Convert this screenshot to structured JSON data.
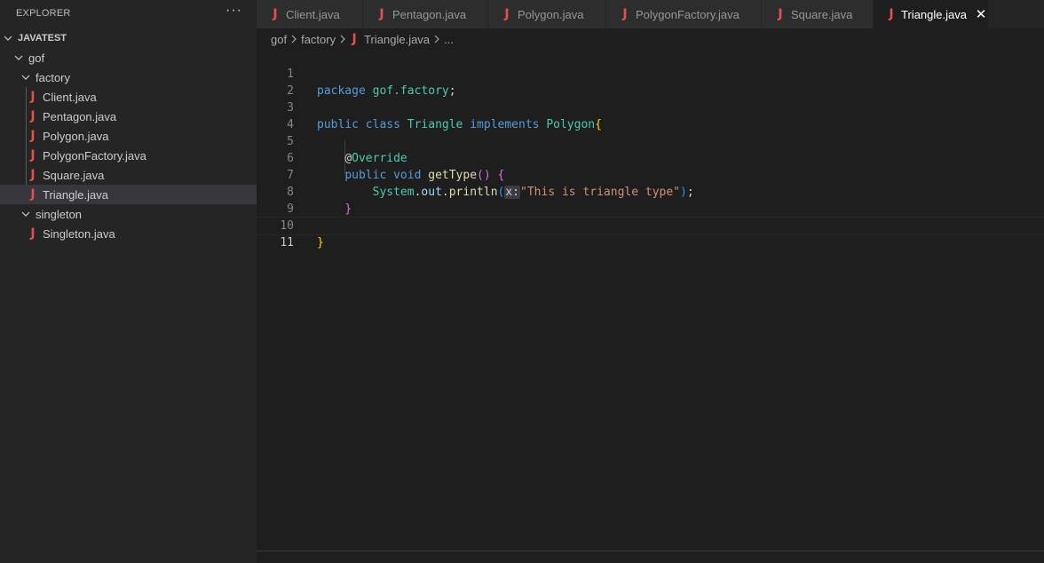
{
  "sidebar": {
    "title": "EXPLORER",
    "more": "···",
    "project": "JAVATEST",
    "folders": {
      "gof": "gof",
      "factory": "factory",
      "singleton": "singleton"
    },
    "factory_files": [
      "Client.java",
      "Pentagon.java",
      "Polygon.java",
      "PolygonFactory.java",
      "Square.java",
      "Triangle.java"
    ],
    "singleton_files": [
      "Singleton.java"
    ],
    "selected": "Triangle.java"
  },
  "tabs": [
    {
      "label": "Client.java",
      "active": false
    },
    {
      "label": "Pentagon.java",
      "active": false
    },
    {
      "label": "Polygon.java",
      "active": false
    },
    {
      "label": "PolygonFactory.java",
      "active": false
    },
    {
      "label": "Square.java",
      "active": false
    },
    {
      "label": "Triangle.java",
      "active": true
    }
  ],
  "tab_close": "✕",
  "file_icon": "J",
  "breadcrumb": {
    "items": [
      "gof",
      "factory",
      "Triangle.java",
      "..."
    ]
  },
  "editor": {
    "line_numbers": [
      "1",
      "2",
      "3",
      "4",
      "5",
      "6",
      "7",
      "8",
      "9",
      "10",
      "11"
    ],
    "current_line": "11",
    "code": {
      "l1": {
        "kw": "package",
        "pkg": "gof.factory",
        "semi": ";"
      },
      "l3": {
        "kw1": "public",
        "kw2": "class",
        "cls": "Triangle",
        "kw3": "implements",
        "iface": "Polygon",
        "brace": "{"
      },
      "l5": {
        "at": "@",
        "ann": "Override"
      },
      "l6": {
        "kw1": "public",
        "kw2": "void",
        "fn": "getType",
        "parens": "()",
        "brace": "{"
      },
      "l7": {
        "obj": "System",
        "dot1": ".",
        "field": "out",
        "dot2": ".",
        "fn": "println",
        "open": "(",
        "hint": "x:",
        "str": "\"This is triangle type\"",
        "close": ")",
        "semi": ";"
      },
      "l9_brace": "}",
      "l10_brace": "}"
    }
  },
  "colors": {
    "keyword": "#569cd6",
    "type": "#4ec9b0",
    "function": "#dcdcaa",
    "string": "#ce9178",
    "java_icon": "#e4504b"
  }
}
